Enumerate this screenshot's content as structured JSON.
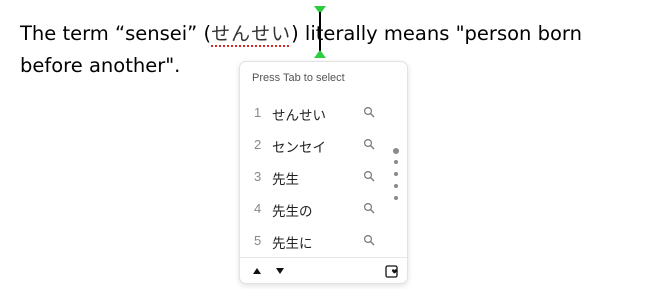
{
  "document": {
    "line1_before": "The term “sensei” (",
    "ime_composition": "せんせい",
    "line1_after": ") literally means \"person born",
    "line2": "before another\"."
  },
  "ime_popup": {
    "hint": "Press Tab to select",
    "candidates": [
      {
        "index": "1",
        "text": "せんせい"
      },
      {
        "index": "2",
        "text": "センセイ"
      },
      {
        "index": "3",
        "text": "先生"
      },
      {
        "index": "4",
        "text": "先生の"
      },
      {
        "index": "5",
        "text": "先生に"
      }
    ],
    "icons": {
      "search": "search-icon",
      "prev": "triangle-up-icon",
      "next": "triangle-down-icon",
      "favorite": "heart-icon"
    }
  },
  "colors": {
    "caret_handle": "#2ecc40",
    "ime_underline": "#d62828"
  }
}
